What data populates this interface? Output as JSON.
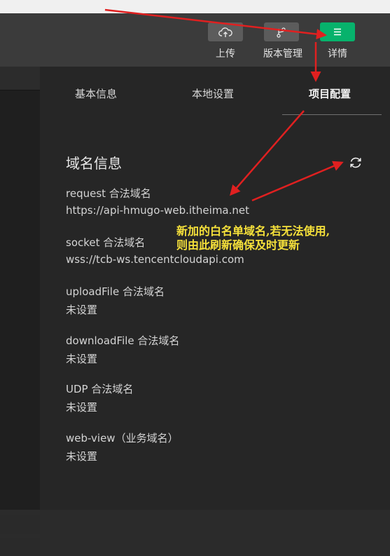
{
  "toolbar": {
    "upload_label": "上传",
    "version_label": "版本管理",
    "details_label": "详情",
    "icons": [
      "cloud-upload-icon",
      "branch-icon",
      "menu-icon"
    ],
    "accent_color": "#07b26c"
  },
  "panel": {
    "tabs": [
      {
        "label": "基本信息",
        "active": false
      },
      {
        "label": "本地设置",
        "active": false
      },
      {
        "label": "项目配置",
        "active": true
      }
    ],
    "section_title": "域名信息",
    "items": [
      {
        "label": "request 合法域名",
        "value": "https://api-hmugo-web.itheima.net"
      },
      {
        "label": "socket 合法域名",
        "value": "wss://tcb-ws.tencentcloudapi.com"
      },
      {
        "label": "uploadFile 合法域名",
        "value": "未设置"
      },
      {
        "label": "downloadFile 合法域名",
        "value": "未设置"
      },
      {
        "label": "UDP 合法域名",
        "value": "未设置"
      },
      {
        "label": "web-view（业务域名）",
        "value": "未设置"
      }
    ]
  },
  "annotation": {
    "line1": "新加的白名单域名,若无法使用,",
    "line2": "则由此刷新确保及时更新",
    "color": "#f5e03a",
    "arrow_color": "#e02020"
  }
}
